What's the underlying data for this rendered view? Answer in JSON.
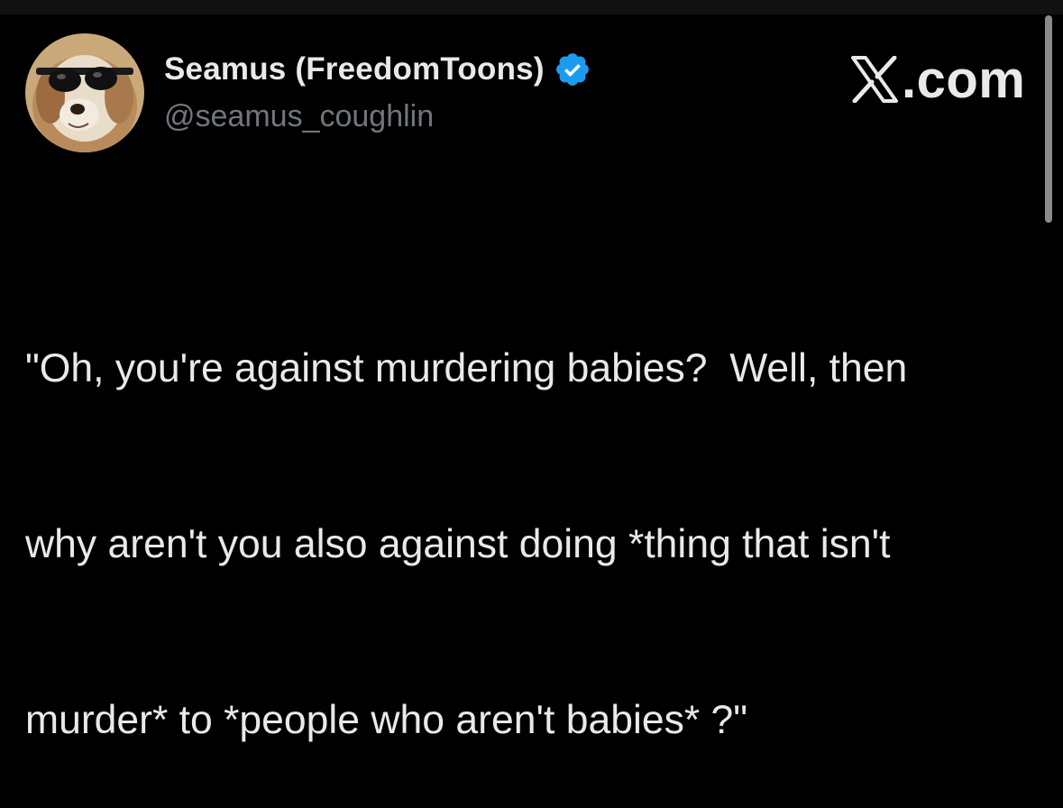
{
  "author": {
    "display_name": "Seamus (FreedomToons)",
    "handle": "@seamus_coughlin",
    "verified": true,
    "verified_color": "#1d9bf0",
    "avatar": "dog-with-sunglasses"
  },
  "brand": {
    "icon": "x-logo-icon",
    "label": ".com"
  },
  "tweet": {
    "lines": [
      "\"Oh, you're against murdering babies?  Well, then",
      "why aren't you also against doing *thing that isn't",
      "murder* to *people who aren't babies* ?\""
    ]
  },
  "colors": {
    "background": "#000000",
    "text": "#e7e9ea",
    "secondary_text": "#71767b"
  }
}
